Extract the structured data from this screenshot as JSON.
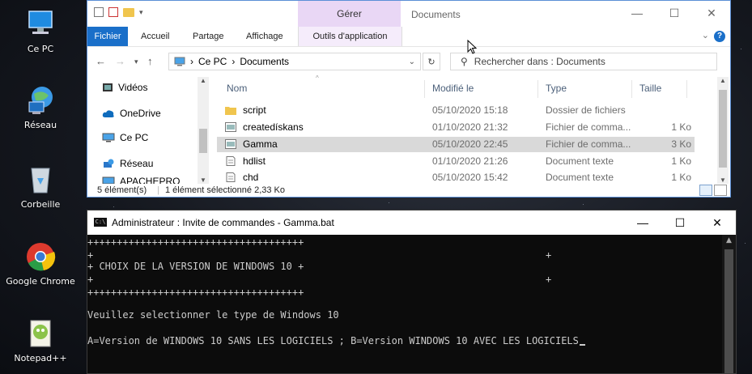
{
  "desktop": {
    "icons": [
      {
        "label": "Ce PC",
        "icon": "computer-icon"
      },
      {
        "label": "Réseau",
        "icon": "network-globe-icon"
      },
      {
        "label": "Corbeille",
        "icon": "recycle-bin-icon"
      },
      {
        "label": "Google Chrome",
        "icon": "chrome-icon"
      },
      {
        "label": "Notepad++",
        "icon": "notepadpp-icon"
      }
    ]
  },
  "explorer": {
    "title": "Documents",
    "context_tab": "Gérer",
    "ribbon_tabs": [
      "Fichier",
      "Accueil",
      "Partage",
      "Affichage",
      "Outils d'application"
    ],
    "window_buttons": {
      "minimize": "—",
      "maximize": "☐",
      "close": "✕"
    },
    "address": {
      "root": "Ce PC",
      "sep": "›",
      "folder": "Documents"
    },
    "search_placeholder": "Rechercher dans : Documents",
    "nav_items": [
      "Vidéos",
      "OneDrive",
      "Ce PC",
      "Réseau",
      "APACHEPRO"
    ],
    "columns": {
      "name": "Nom",
      "modified": "Modifié le",
      "type": "Type",
      "size": "Taille"
    },
    "files": [
      {
        "name": "script",
        "modified": "05/10/2020 15:18",
        "type": "Dossier de fichiers",
        "size": "",
        "icon": "folder-icon"
      },
      {
        "name": "createdískans",
        "modified": "01/10/2020 21:32",
        "type": "Fichier de comma...",
        "size": "1 Ko",
        "icon": "batch-file-icon"
      },
      {
        "name": "Gamma",
        "modified": "05/10/2020 22:45",
        "type": "Fichier de comma...",
        "size": "3 Ko",
        "icon": "batch-file-icon",
        "selected": true
      },
      {
        "name": "hdlist",
        "modified": "01/10/2020 21:26",
        "type": "Document texte",
        "size": "1 Ko",
        "icon": "text-file-icon"
      },
      {
        "name": "chd",
        "modified": "05/10/2020 15:42",
        "type": "Document texte",
        "size": "1 Ko",
        "icon": "text-file-icon"
      }
    ],
    "status": {
      "count": "5 élément(s)",
      "selection": "1 élément sélectionné  2,33 Ko"
    }
  },
  "cmd": {
    "title": "Administrateur : Invite de commandes - Gamma.bat",
    "icon_text": "C:\\",
    "window_buttons": {
      "minimize": "—",
      "maximize": "☐",
      "close": "✕"
    },
    "lines": {
      "border1": "+++++++++++++++++++++++++++++++++++++",
      "plus_left": "+",
      "plus_right": "+",
      "header": "+ CHOIX DE LA VERSION DE WINDOWS 10 +",
      "plus_left2": "+",
      "plus_right2": "+",
      "border2": "+++++++++++++++++++++++++++++++++++++",
      "prompt": "Veuillez selectionner le type de Windows 10",
      "options": "A=Version de WINDOWS 10 SANS LES LOGICIELS ; B=Version WINDOWS 10 AVEC LES LOGICIELS"
    }
  }
}
